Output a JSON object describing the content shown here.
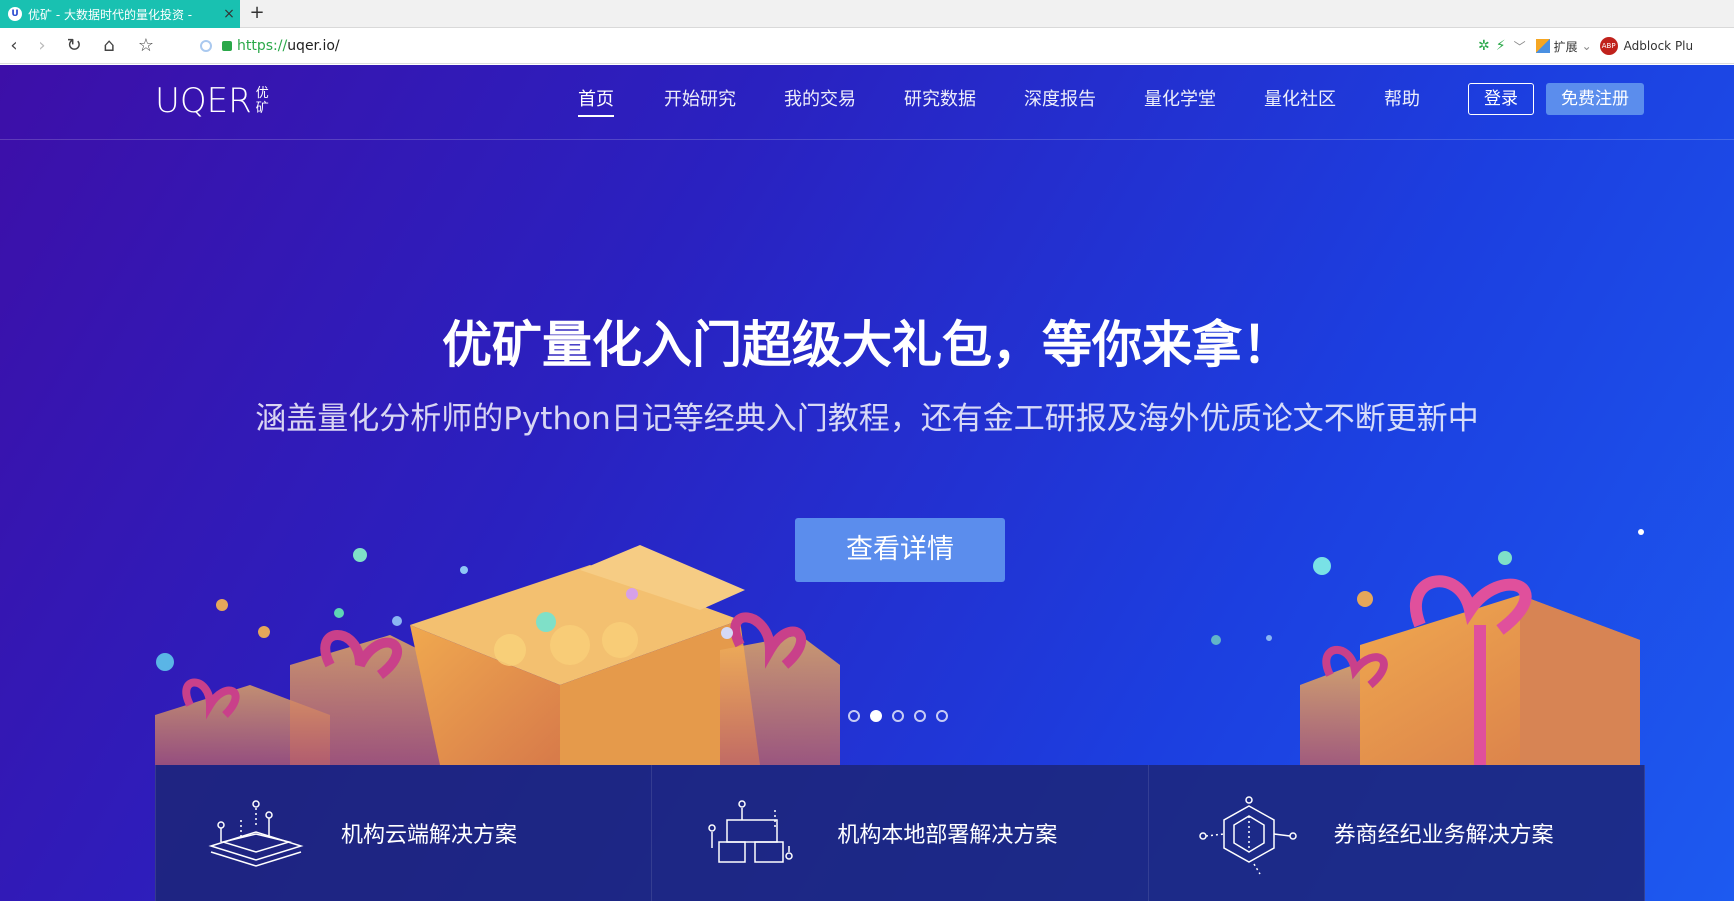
{
  "browser": {
    "tab_title": "优矿 - 大数据时代的量化投资 -",
    "tab_favicon": "U",
    "tab_close": "×",
    "new_tab": "+",
    "url_scheme": "https://",
    "url_host": "uqer.io/",
    "extensions_label": "扩展",
    "adblock_label": "Adblock Plu",
    "adblock_badge": "ABP"
  },
  "nav": {
    "logo_text": "UQER",
    "logo_cn": "优矿",
    "items": [
      "首页",
      "开始研究",
      "我的交易",
      "研究数据",
      "深度报告",
      "量化学堂",
      "量化社区",
      "帮助"
    ],
    "login": "登录",
    "register": "免费注册"
  },
  "hero": {
    "headline": "优矿量化入门超级大礼包，等你来拿！",
    "subline": "涵盖量化分析师的Python日记等经典入门教程，还有金工研报及海外优质论文不断更新中",
    "cta": "查看详情",
    "carousel_active": 2,
    "carousel_total": 5
  },
  "solutions": [
    {
      "label": "机构云端解决方案",
      "icon": "cloud-layers-icon"
    },
    {
      "label": "机构本地部署解决方案",
      "icon": "local-deploy-icon"
    },
    {
      "label": "券商经纪业务解决方案",
      "icon": "hexagon-broker-icon"
    }
  ],
  "colors": {
    "tab_accent": "#19c1b1",
    "hero_start": "#3d0fa8",
    "hero_end": "#1d5af0",
    "button_blue": "#5b8ded"
  }
}
